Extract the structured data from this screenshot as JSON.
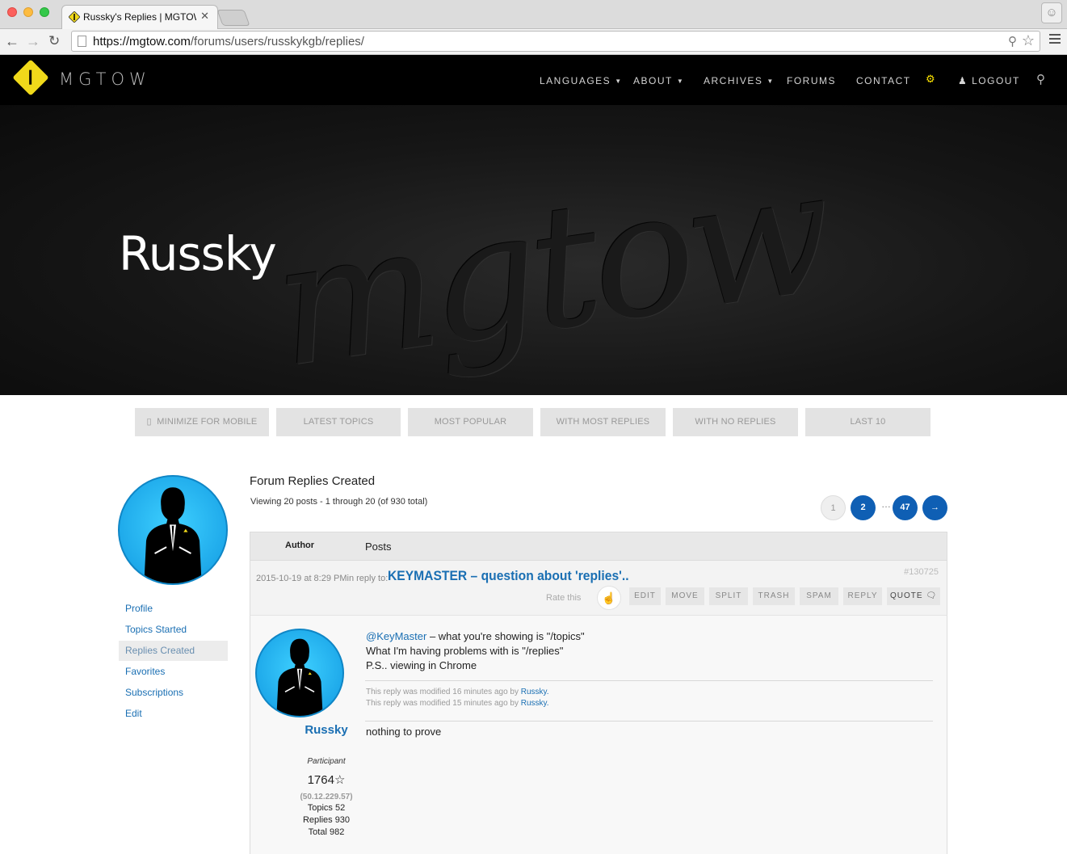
{
  "browser": {
    "tab_title": "Russky's Replies | MGTOW",
    "tab_close": "✕",
    "url_host": "https://mgtow.com",
    "url_path": "/forums/users/russkykgb/replies/"
  },
  "site": {
    "logo_text": "MGTOW",
    "nav": {
      "languages": "LANGUAGES",
      "about": "ABOUT",
      "archives": "ARCHIVES",
      "forums": "FORUMS",
      "contact": "CONTACT",
      "logout": "LOGOUT"
    },
    "accent_color": "#f0d91a"
  },
  "hero": {
    "title": "Russky",
    "script_text": "mgtow"
  },
  "filters": [
    "MINIMIZE FOR MOBILE",
    "LATEST TOPICS",
    "MOST POPULAR",
    "WITH MOST REPLIES",
    "WITH NO REPLIES",
    "LAST 10"
  ],
  "sidebar": {
    "links": [
      "Profile",
      "Topics Started",
      "Replies Created",
      "Favorites",
      "Subscriptions",
      "Edit"
    ],
    "active": "Replies Created"
  },
  "main": {
    "title": "Forum Replies Created",
    "viewing": "Viewing 20 posts - 1 through 20 (of 930 total)",
    "pagination": {
      "current": "1",
      "next_page": "2",
      "dots": "…",
      "last": "47",
      "next_arrow": "→"
    },
    "table_head": {
      "author": "Author",
      "posts": "Posts"
    }
  },
  "reply": {
    "date": "2015-10-19 at 8:29 PM",
    "in_reply_to": "in reply to:",
    "topic_link": "KEYMASTER – question about 'replies'..",
    "post_id": "#130725",
    "rate_label": "Rate this",
    "admin_links": [
      "EDIT",
      "MOVE",
      "SPLIT",
      "TRASH",
      "SPAM",
      "REPLY",
      "QUOTE"
    ],
    "author": {
      "name": "Russky",
      "role": "Participant",
      "reputation": "1764",
      "ip": "(50.12.229.57)",
      "topics": "Topics 52",
      "replies": "Replies 930",
      "total": "Total 982"
    },
    "body": {
      "mention": "@KeyMaster",
      "line1_rest": " – what you're showing is \"/topics\"",
      "line2": "What I'm having problems with is \"/replies\"",
      "line3": "P.S.. viewing in Chrome"
    },
    "modified": [
      {
        "text": "This reply was modified 16 minutes ago by",
        "user": "Russky."
      },
      {
        "text": "This reply was modified 15 minutes ago by",
        "user": "Russky."
      }
    ],
    "signature": "nothing to prove"
  }
}
